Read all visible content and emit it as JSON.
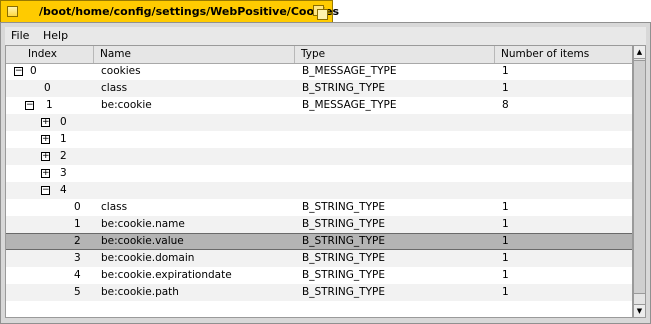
{
  "window": {
    "title": "/boot/home/config/settings/WebPositive/Cookies"
  },
  "menu": {
    "file": "File",
    "help": "Help"
  },
  "columns": {
    "index": "Index",
    "name": "Name",
    "type": "Type",
    "count": "Number of items"
  },
  "rows": [
    {
      "index": "0",
      "name": "cookies",
      "type": "B_MESSAGE_TYPE",
      "count": "1",
      "expander": "−"
    },
    {
      "index": "0",
      "name": "class",
      "type": "B_STRING_TYPE",
      "count": "1"
    },
    {
      "index": "1",
      "name": "be:cookie",
      "type": "B_MESSAGE_TYPE",
      "count": "8",
      "expander": "−"
    },
    {
      "index": "0",
      "name": "",
      "type": "",
      "count": "",
      "expander": "+"
    },
    {
      "index": "1",
      "name": "",
      "type": "",
      "count": "",
      "expander": "+"
    },
    {
      "index": "2",
      "name": "",
      "type": "",
      "count": "",
      "expander": "+"
    },
    {
      "index": "3",
      "name": "",
      "type": "",
      "count": "",
      "expander": "+"
    },
    {
      "index": "4",
      "name": "",
      "type": "",
      "count": "",
      "expander": "−"
    },
    {
      "index": "0",
      "name": "class",
      "type": "B_STRING_TYPE",
      "count": "1"
    },
    {
      "index": "1",
      "name": "be:cookie.name",
      "type": "B_STRING_TYPE",
      "count": "1"
    },
    {
      "index": "2",
      "name": "be:cookie.value",
      "type": "B_STRING_TYPE",
      "count": "1",
      "selected": true
    },
    {
      "index": "3",
      "name": "be:cookie.domain",
      "type": "B_STRING_TYPE",
      "count": "1"
    },
    {
      "index": "4",
      "name": "be:cookie.expirationdate",
      "type": "B_STRING_TYPE",
      "count": "1"
    },
    {
      "index": "5",
      "name": "be:cookie.path",
      "type": "B_STRING_TYPE",
      "count": "1"
    }
  ],
  "scrollbar": {
    "up_icon": "arrow-up-icon",
    "down_icon": "arrow-down-icon"
  }
}
